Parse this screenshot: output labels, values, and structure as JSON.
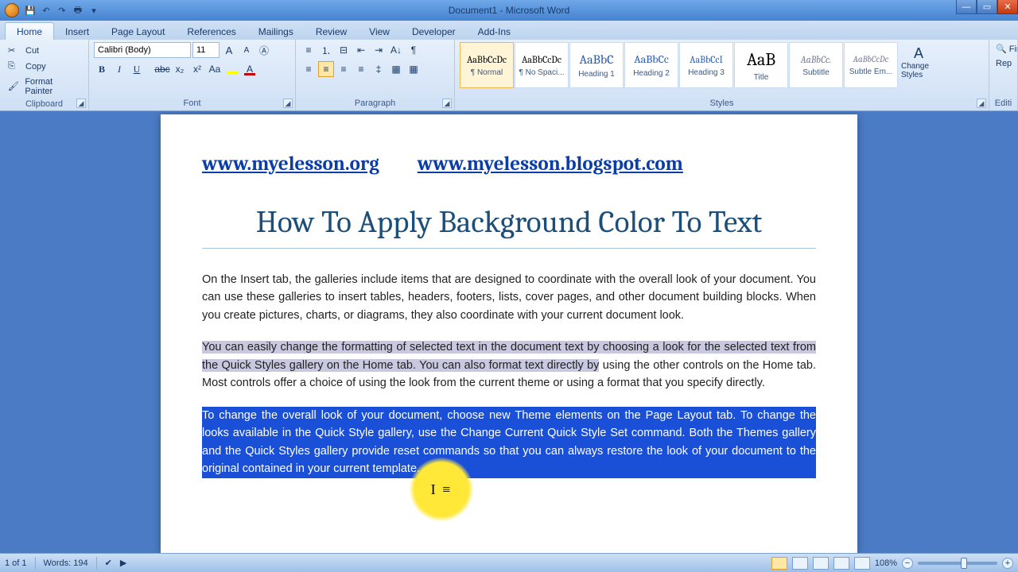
{
  "title": "Document1 - Microsoft Word",
  "tabs": [
    "Home",
    "Insert",
    "Page Layout",
    "References",
    "Mailings",
    "Review",
    "View",
    "Developer",
    "Add-Ins"
  ],
  "active_tab": 0,
  "clipboard": {
    "cut": "Cut",
    "copy": "Copy",
    "format_painter": "Format Painter",
    "label": "Clipboard"
  },
  "font": {
    "name": "Calibri (Body)",
    "size": "11",
    "label": "Font"
  },
  "paragraph": {
    "label": "Paragraph"
  },
  "styles": {
    "label": "Styles",
    "items": [
      {
        "preview": "AaBbCcDc",
        "label": "¶ Normal",
        "color": "#000",
        "size": "12px"
      },
      {
        "preview": "AaBbCcDc",
        "label": "¶ No Spaci...",
        "color": "#000",
        "size": "12px"
      },
      {
        "preview": "AaBbC",
        "label": "Heading 1",
        "color": "#2a5aa8",
        "size": "16px"
      },
      {
        "preview": "AaBbCc",
        "label": "Heading 2",
        "color": "#2a5aa8",
        "size": "14px"
      },
      {
        "preview": "AaBbCcI",
        "label": "Heading 3",
        "color": "#2a5aa8",
        "size": "12px"
      },
      {
        "preview": "AaB",
        "label": "Title",
        "color": "#000",
        "size": "22px"
      },
      {
        "preview": "AaBbCc.",
        "label": "Subtitle",
        "color": "#7a7a9a",
        "size": "12px",
        "italic": true
      },
      {
        "preview": "AaBbCcDc",
        "label": "Subtle Em...",
        "color": "#7a7a9a",
        "size": "11px",
        "italic": true
      }
    ],
    "change": "Change Styles"
  },
  "editing": {
    "find": "Fin",
    "replace": "Rep",
    "label": "Editi"
  },
  "document": {
    "link1": "www.myelesson.org",
    "link2": "www.myelesson.blogspot.com",
    "heading": "How To Apply Background Color To Text",
    "p1": "On the Insert tab, the galleries include items that are designed to coordinate with the overall look of your document. You can use these galleries to insert tables, headers, footers, lists, cover pages, and other document building blocks. When you create pictures, charts, or diagrams, they also coordinate with your current document look.",
    "p2a": "You can easily change the formatting of selected text in the document text by choosing a look for the selected text from the Quick Styles gallery on the Home tab. You can also format text directly by",
    "p2b": " using the other controls on the Home tab. Most controls offer a choice of using the look from the current theme or using a format that you specify directly.",
    "p3": "To change the overall look of your document, choose new Theme elements on the Page Layout tab. To change the looks available in the Quick Style gallery, use the Change Current Quick Style Set command. Both the Themes gallery and the Quick Styles gallery provide reset commands so that you can always restore the look of your document to the original contained in your current template."
  },
  "status": {
    "page": "1 of 1",
    "words": "Words: 194",
    "zoom": "108%"
  }
}
